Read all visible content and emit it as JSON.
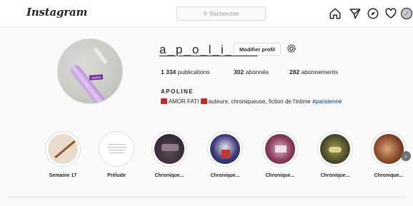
{
  "topbar": {
    "logo_text": "Instagram",
    "search": {
      "placeholder": "Rechercher",
      "icon": "search-icon"
    },
    "nav_icons": [
      "home-icon",
      "direct-icon",
      "explore-icon",
      "heart-icon",
      "avatar-icon"
    ]
  },
  "profile": {
    "username": "a_p_o_l_i_n_e",
    "edit_label": "Modifier profil",
    "pen_label": "Apoline",
    "stats": [
      {
        "count": "1 334",
        "label": "publications"
      },
      {
        "count": "302",
        "label": "abonnés"
      },
      {
        "count": "282",
        "label": "abonnements"
      }
    ],
    "fullname": "APOLINE",
    "bio": {
      "main": "AMOR FATI",
      "rest": " auteure, chroniqueuse, fiction de l'intime ",
      "hashtag": "#parisienne"
    }
  },
  "highlights": [
    {
      "label": "Semaine 17"
    },
    {
      "label": "Prélude"
    },
    {
      "label": "Chronique..."
    },
    {
      "label": "Chronique..."
    },
    {
      "label": "Chronique..."
    },
    {
      "label": "Chronique..."
    },
    {
      "label": "Chronique..."
    }
  ],
  "colors": {
    "accent_link": "#00376b",
    "book_emoji": "#c7262e",
    "pen_purple": "#c39be0"
  }
}
